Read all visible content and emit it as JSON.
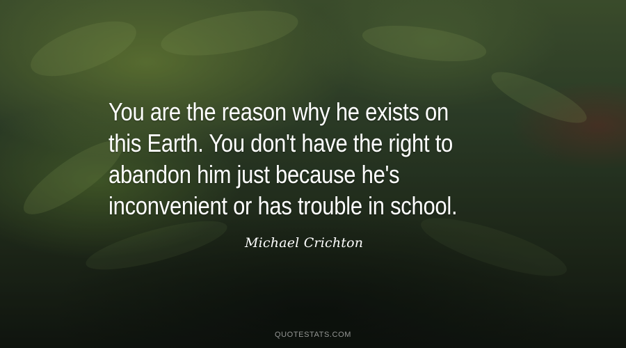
{
  "background": {
    "description_icon": "fern-leaves-image",
    "colors": {
      "top": "#4b6138",
      "middle": "#364a30",
      "bottom": "#141a13",
      "accent_red": "#963030"
    }
  },
  "quote": {
    "lines": [
      "You are the reason why he exists on",
      "this Earth. You don't have the right to",
      "abandon him just because he's",
      "inconvenient or has trouble in school."
    ]
  },
  "author": "Michael Crichton",
  "footer": {
    "site": "QUOTESTATS.COM"
  }
}
